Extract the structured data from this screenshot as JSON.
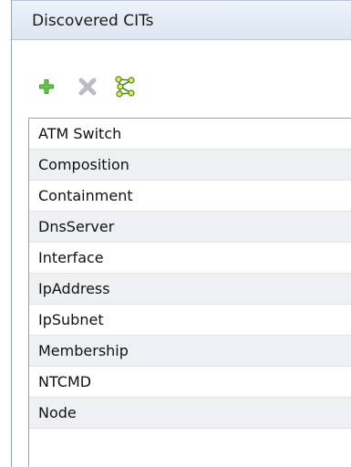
{
  "panel": {
    "title": "Discovered CITs"
  },
  "toolbar": {
    "buttons": [
      {
        "icon": "plus-icon",
        "color": "#3a9a2a",
        "enabled": true
      },
      {
        "icon": "delete-x-icon",
        "color": "#b9bec6",
        "enabled": false
      },
      {
        "icon": "topology-icon",
        "color": "#4a8a1c",
        "enabled": true
      }
    ]
  },
  "list": {
    "items": [
      {
        "label": "ATM Switch"
      },
      {
        "label": "Composition"
      },
      {
        "label": "Containment"
      },
      {
        "label": "DnsServer"
      },
      {
        "label": "Interface"
      },
      {
        "label": "IpAddress"
      },
      {
        "label": "IpSubnet"
      },
      {
        "label": "Membership"
      },
      {
        "label": "NTCMD"
      },
      {
        "label": "Node"
      }
    ]
  }
}
